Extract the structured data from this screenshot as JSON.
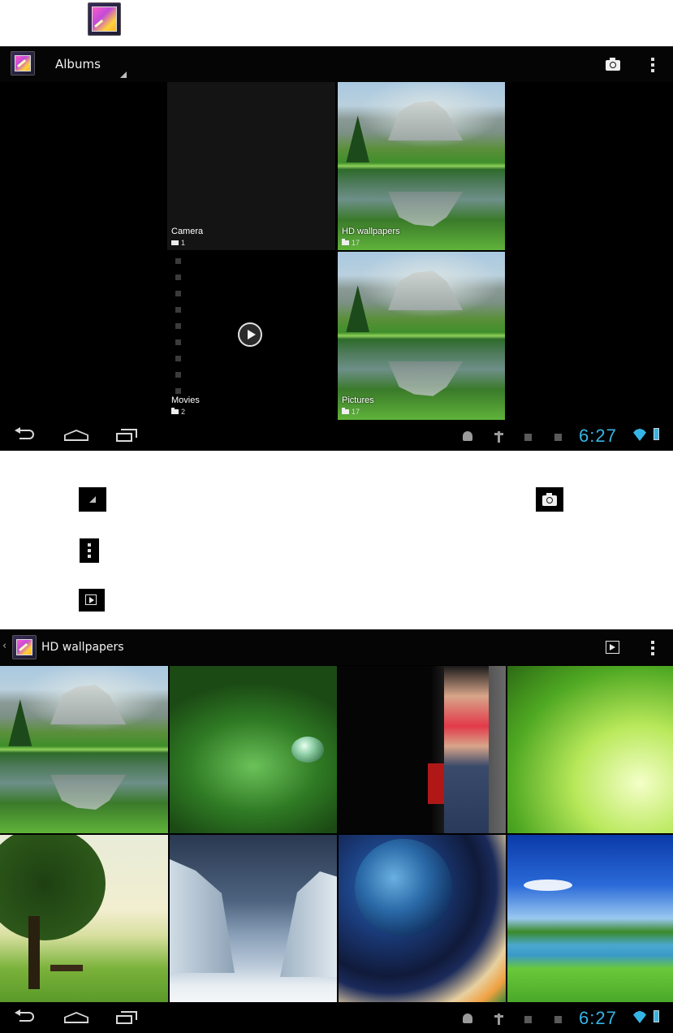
{
  "screen1": {
    "action_bar": {
      "title": "Albums",
      "camera_icon": "camera-icon",
      "overflow_icon": "overflow-menu-icon"
    },
    "albums": [
      {
        "name": "Camera",
        "count": "1",
        "count_icon": "camera-small-icon"
      },
      {
        "name": "HD wallpapers",
        "count": "17",
        "count_icon": "folder-icon"
      },
      {
        "name": "Movies",
        "count": "2",
        "count_icon": "folder-icon"
      },
      {
        "name": "Pictures",
        "count": "17",
        "count_icon": "folder-icon"
      }
    ],
    "status": {
      "clock": "6:27"
    }
  },
  "legend_icons": [
    "dropdown-corner-icon",
    "camera-icon",
    "overflow-menu-icon",
    "slideshow-play-icon"
  ],
  "screen2": {
    "action_bar": {
      "title": "HD wallpapers",
      "slideshow_icon": "slideshow-play-icon",
      "overflow_icon": "overflow-menu-icon"
    },
    "photos": [
      "yosemite-landscape",
      "water-drop",
      "woman-portrait",
      "green-leaves",
      "tree-bench-sunset",
      "ice-cliffs",
      "earth-space",
      "lake-landscape"
    ],
    "status": {
      "clock": "6:27"
    }
  },
  "colors": {
    "accent": "#35b5e5",
    "bar": "#000000",
    "page": "#ffffff"
  }
}
